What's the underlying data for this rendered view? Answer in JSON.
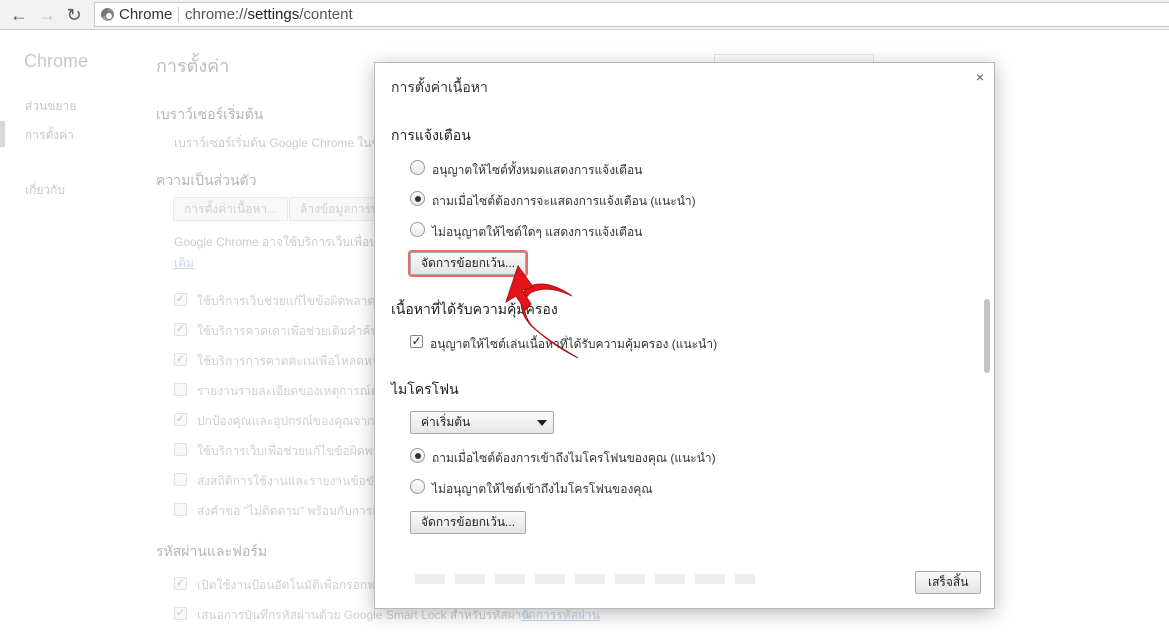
{
  "browser": {
    "back_glyph": "←",
    "forward_glyph": "→",
    "reload_glyph": "↻",
    "omnibox_chip": "Chrome",
    "url_scheme": "chrome://",
    "url_host": "settings",
    "url_path": "/content"
  },
  "settings_page": {
    "brand": "Chrome",
    "sidebar": [
      "ส่วนขยาย",
      "การตั้งค่า",
      "เกี่ยวกับ"
    ],
    "title": "การตั้งค่า",
    "startup": {
      "heading": "เบราว์เซอร์เริ่มต้น",
      "text": "เบราว์เซอร์เริ่มต้น Google Chrome ในขณ"
    },
    "privacy": {
      "heading": "ความเป็นส่วนตัว",
      "content_settings_button": "การตั้งค่าเนื้อหา...",
      "clear_data_button": "ล้างข้อมูลการท่",
      "description": "Google Chrome อาจใช้บริการเว็บเพื่อป",
      "more_link": "เติม",
      "checkboxes": [
        {
          "label": "ใช้บริการเว็บช่วยแก้ไขข้อผิดพลาดใน",
          "checked": true
        },
        {
          "label": "ใช้บริการคาดเดาเพื่อช่วยเติมคำค้นห",
          "checked": true
        },
        {
          "label": "ใช้บริการการคาดคะเนเพื่อโหลดหน้",
          "checked": true
        },
        {
          "label": "รายงานรายละเอียดของเหตุการณ์ด้า",
          "checked": false
        },
        {
          "label": "ปกป้องคุณและอุปกรณ์ของคุณจากเว็",
          "checked": true
        },
        {
          "label": "ใช้บริการเว็บเพื่อช่วยแก้ไขข้อผิดพลา",
          "checked": false
        },
        {
          "label": "ส่งสถิติการใช้งานและรายงานข้อขัดข้",
          "checked": false
        },
        {
          "label": "ส่งคำขอ \"ไม่ติดตาม\" พร้อมกับการเข",
          "checked": false
        }
      ]
    },
    "passwords": {
      "heading": "รหัสผ่านและฟอร์ม",
      "checkboxes": [
        {
          "label": "เปิดใช้งานป้อนอัตโนมัติเพื่อกรอกฟอ",
          "checked": true
        },
        {
          "label": "เสนอการบันทึกรหัสผ่านด้วย Google Smart Lock สำหรับรหัสผ่าน",
          "checked": true
        }
      ],
      "manage_link": "จัดการรหัสผ่าน"
    }
  },
  "dialog": {
    "title": "การตั้งค่าเนื้อหา",
    "close_glyph": "×",
    "notifications": {
      "heading": "การแจ้งเตือน",
      "options": [
        {
          "label": "อนุญาตให้ไซต์ทั้งหมดแสดงการแจ้งเตือน",
          "selected": false
        },
        {
          "label": "ถามเมื่อไซต์ต้องการจะแสดงการแจ้งเตือน (แนะนำ)",
          "selected": true
        },
        {
          "label": "ไม่อนุญาตให้ไซต์ใดๆ แสดงการแจ้งเตือน",
          "selected": false
        }
      ],
      "manage_button": "จัดการข้อยกเว้น..."
    },
    "protected_content": {
      "heading": "เนื้อหาที่ได้รับความคุ้มครอง",
      "checkbox_label": "อนุญาตให้ไซต์เล่นเนื้อหาที่ได้รับความคุ้มครอง (แนะนำ)",
      "checked": true
    },
    "microphone": {
      "heading": "ไมโครโฟน",
      "select_value": "ค่าเริ่มต้น",
      "options": [
        {
          "label": "ถามเมื่อไซต์ต้องการเข้าถึงไมโครโฟนของคุณ (แนะนำ)",
          "selected": true
        },
        {
          "label": "ไม่อนุญาตให้ไซต์เข้าถึงไมโครโฟนของคุณ",
          "selected": false
        }
      ],
      "manage_button": "จัดการข้อยกเว้น..."
    },
    "done_button": "เสร็จสิ้น"
  },
  "annotation": {
    "arrow_color": "#e3151a",
    "highlight_color": "#e86a6a"
  }
}
